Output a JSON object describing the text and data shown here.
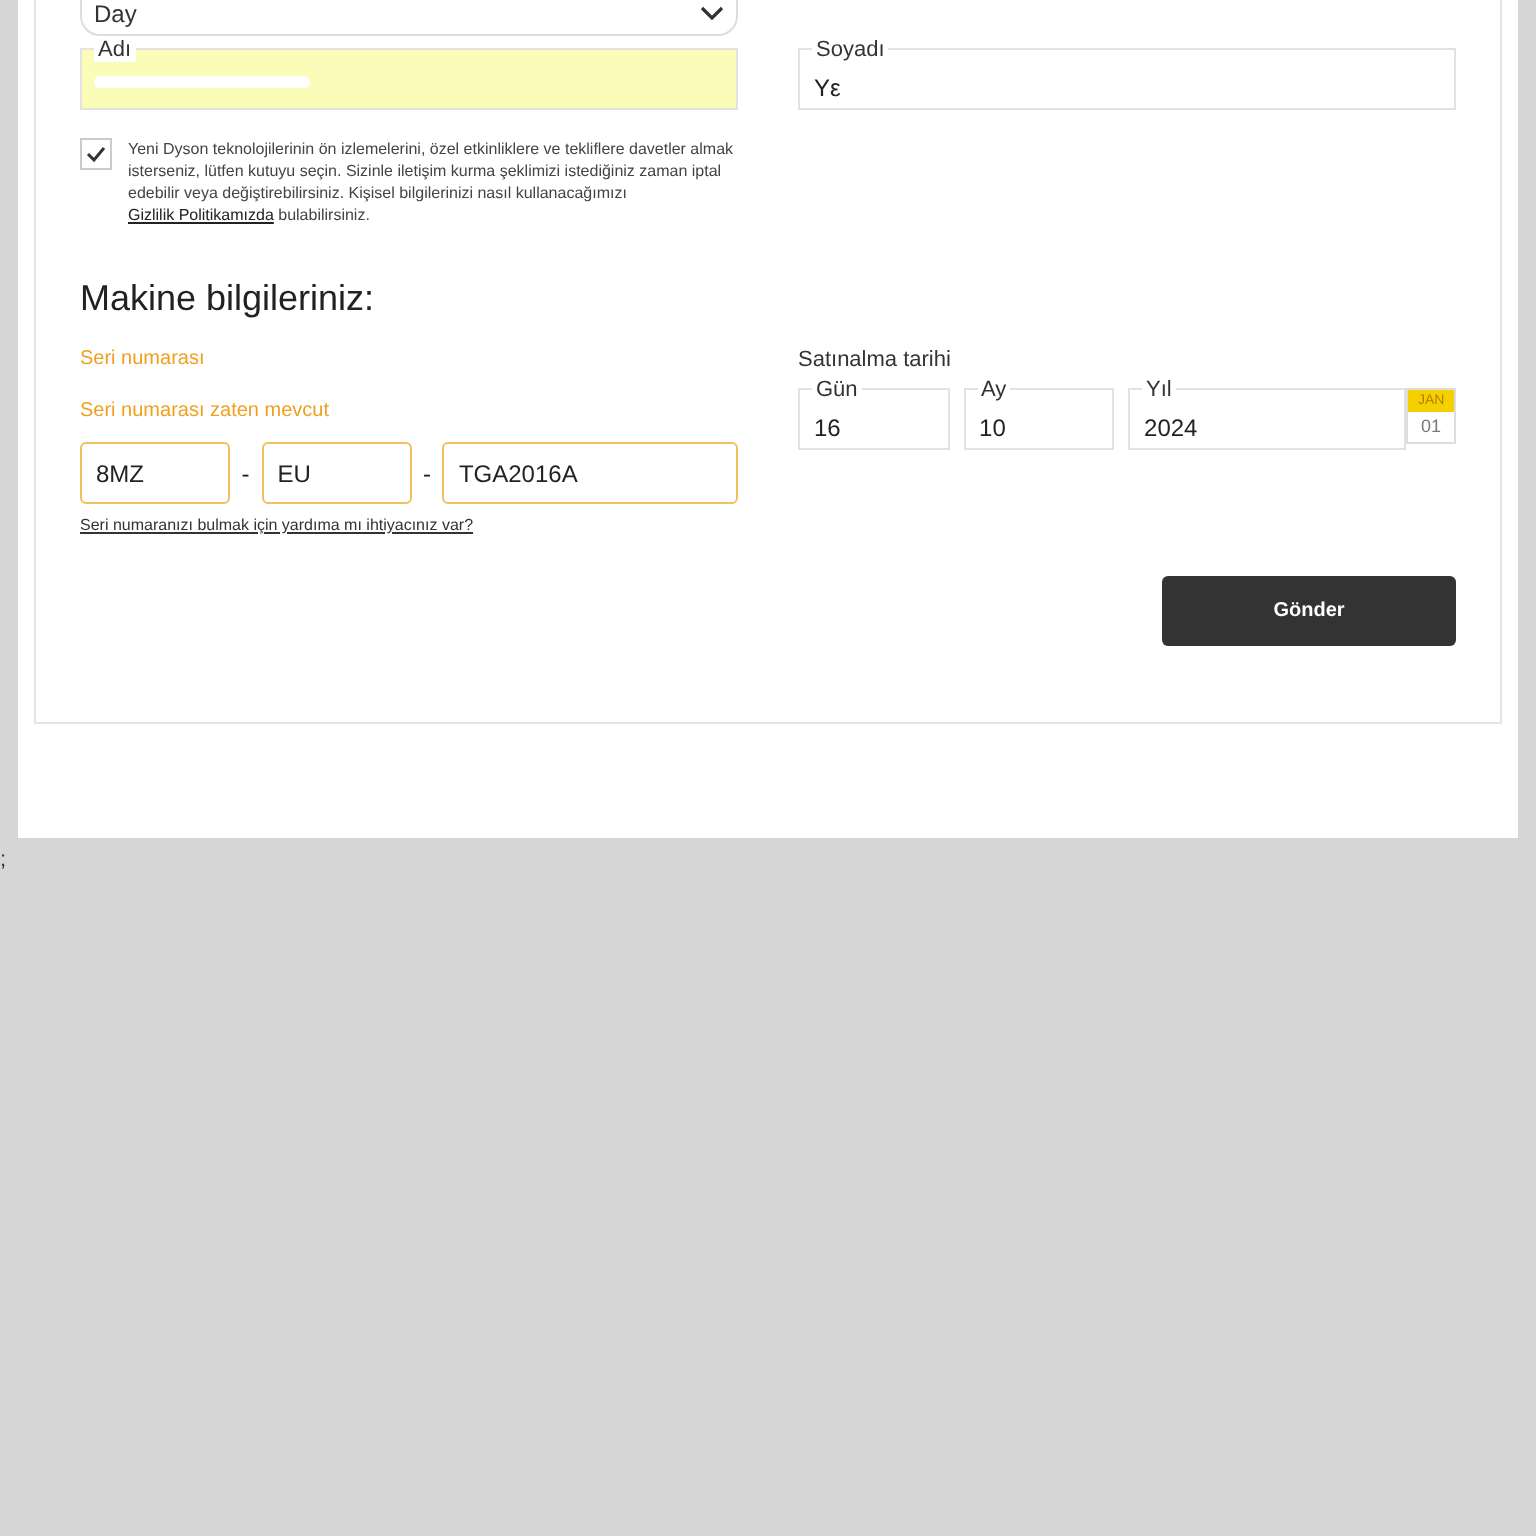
{
  "top_select": {
    "value": "Day"
  },
  "name_fields": [
    {
      "label": "Adı",
      "autofilled": true,
      "redacted": true
    },
    {
      "label": "Soyadı",
      "value": "Yε",
      "autofilled": false,
      "redacted": false
    }
  ],
  "consent": {
    "checked": true,
    "text_before": "Yeni Dyson teknolojilerinin ön izlemelerini, özel etkinliklere ve tekliflere davetler almak isterseniz, lütfen kutuyu seçin. Sizinle iletişim kurma şeklimizi istediğiniz zaman iptal edebilir veya değiştirebilirsiniz. Kişisel bilgilerinizi nasıl kullanacağımızı",
    "link": "Gizlilik Politikamızda",
    "text_after": "bulabilirsiniz."
  },
  "machine_section": {
    "title": "Makine bilgileriniz:",
    "serial_label": "Seri numarası",
    "serial_error": "Seri numarası zaten mevcut",
    "serial_parts": [
      "8MZ",
      "EU",
      "TGA2016A"
    ],
    "separator": "-",
    "help_link": "Seri numaranızı bulmak için yardıma mı ihtiyacınız var?"
  },
  "purchase_date": {
    "label": "Satınalma tarihi",
    "fields": [
      {
        "label": "Gün",
        "value": "16"
      },
      {
        "label": "Ay",
        "value": "10"
      },
      {
        "label": "Yıl",
        "value": "2024"
      }
    ],
    "calendar": {
      "month": "JAN",
      "day": "01"
    }
  },
  "submit_button": "Gönder",
  "stray_text": ";"
}
